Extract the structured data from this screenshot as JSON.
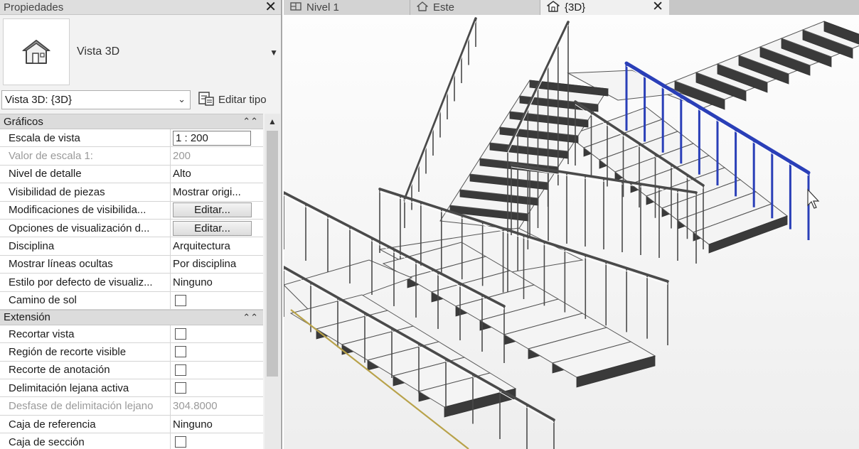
{
  "panel": {
    "title": "Propiedades",
    "type_name": "Vista 3D",
    "view_selector": "Vista 3D: {3D}",
    "edit_type_label": "Editar tipo"
  },
  "groups": {
    "graficos": {
      "label": "Gráficos",
      "rows": {
        "escala": {
          "name": "Escala de vista",
          "value": "1 : 200"
        },
        "valor_escala": {
          "name": "Valor de escala    1:",
          "value": "200"
        },
        "nivel_detalle": {
          "name": "Nivel de detalle",
          "value": "Alto"
        },
        "visibilidad_piezas": {
          "name": "Visibilidad de piezas",
          "value": "Mostrar origi..."
        },
        "mod_visibilidad": {
          "name": "Modificaciones de visibilida...",
          "value": "Editar..."
        },
        "opciones_visualizacion": {
          "name": "Opciones de visualización d...",
          "value": "Editar..."
        },
        "disciplina": {
          "name": "Disciplina",
          "value": "Arquitectura"
        },
        "lineas_ocultas": {
          "name": "Mostrar líneas ocultas",
          "value": "Por disciplina"
        },
        "estilo_defecto": {
          "name": "Estilo por defecto de visualiz...",
          "value": "Ninguno"
        },
        "camino_sol": {
          "name": "Camino de sol",
          "checked": false
        }
      }
    },
    "extension": {
      "label": "Extensión",
      "rows": {
        "recortar_vista": {
          "name": "Recortar vista",
          "checked": false
        },
        "region_recorte": {
          "name": "Región de recorte visible",
          "checked": false
        },
        "recorte_anotacion": {
          "name": "Recorte de anotación",
          "checked": false
        },
        "delimitacion_lejana": {
          "name": "Delimitación lejana activa",
          "checked": false
        },
        "desfase_delimitacion": {
          "name": "Desfase de delimitación lejano",
          "value": "304.8000"
        },
        "caja_referencia": {
          "name": "Caja de referencia",
          "value": "Ninguno"
        },
        "caja_seccion": {
          "name": "Caja de sección",
          "checked": false
        }
      }
    }
  },
  "tabs": {
    "nivel1": {
      "label": "Nivel 1"
    },
    "este": {
      "label": "Este"
    },
    "view3d": {
      "label": "{3D}"
    }
  },
  "colors": {
    "selected_railing": "#2a3fb8",
    "stair_shadow": "#3a3a3a",
    "tread": "#f4f4f4"
  }
}
